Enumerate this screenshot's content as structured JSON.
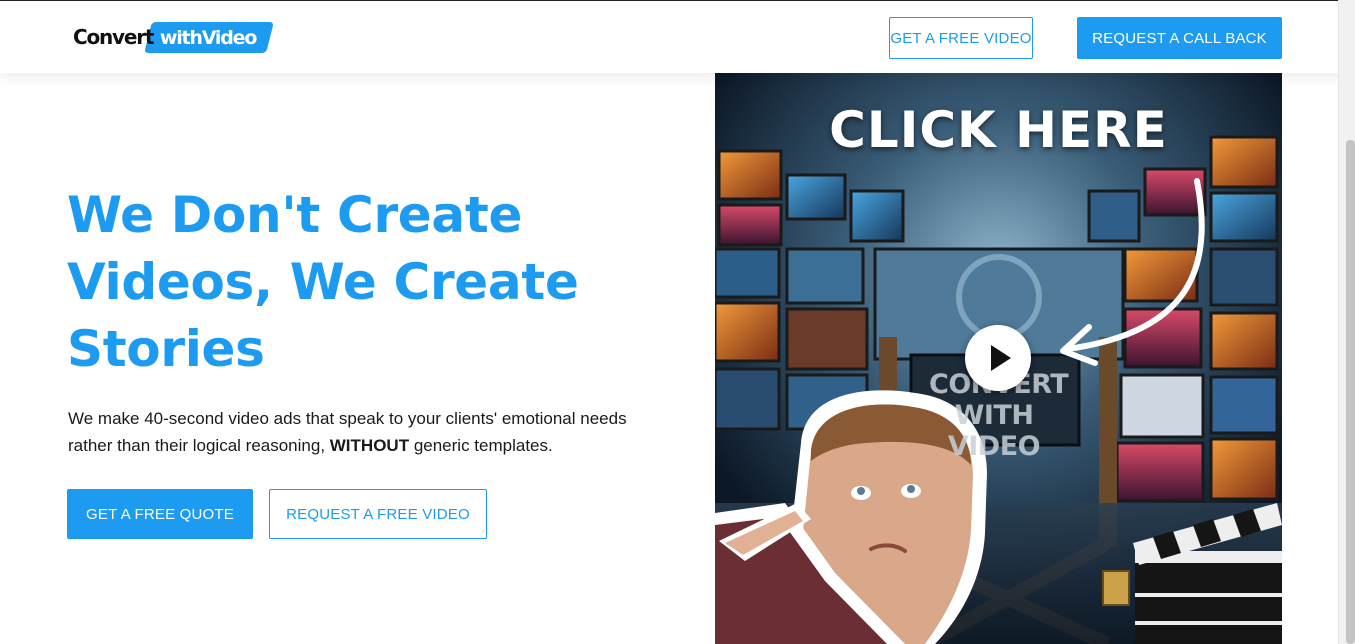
{
  "header": {
    "logo": {
      "part1": "Convert",
      "part2": "withVideo"
    },
    "buttons": {
      "free_video": "GET A FREE VIDEO",
      "call_back": "REQUEST A CALL BACK"
    }
  },
  "hero": {
    "headline": "We Don't Create Videos, We Create Stories",
    "subtext_before": "We make 40-second video ads that speak to your clients' emotional needs rather than their logical reasoning, ",
    "subtext_bold": "WITHOUT",
    "subtext_after": " generic templates.",
    "buttons": {
      "free_quote": "GET A FREE QUOTE",
      "free_video": "REQUEST A FREE VIDEO"
    }
  },
  "video": {
    "overlay_text": "CLICK HERE",
    "chair_text_line1": "CONVERT",
    "chair_text_line2": "WITH VIDEO"
  },
  "colors": {
    "brand_blue": "#1c9bf0",
    "text_dark": "#1a1a1a"
  },
  "icons": {
    "play": "play-icon",
    "arrow": "curved-arrow-icon"
  }
}
